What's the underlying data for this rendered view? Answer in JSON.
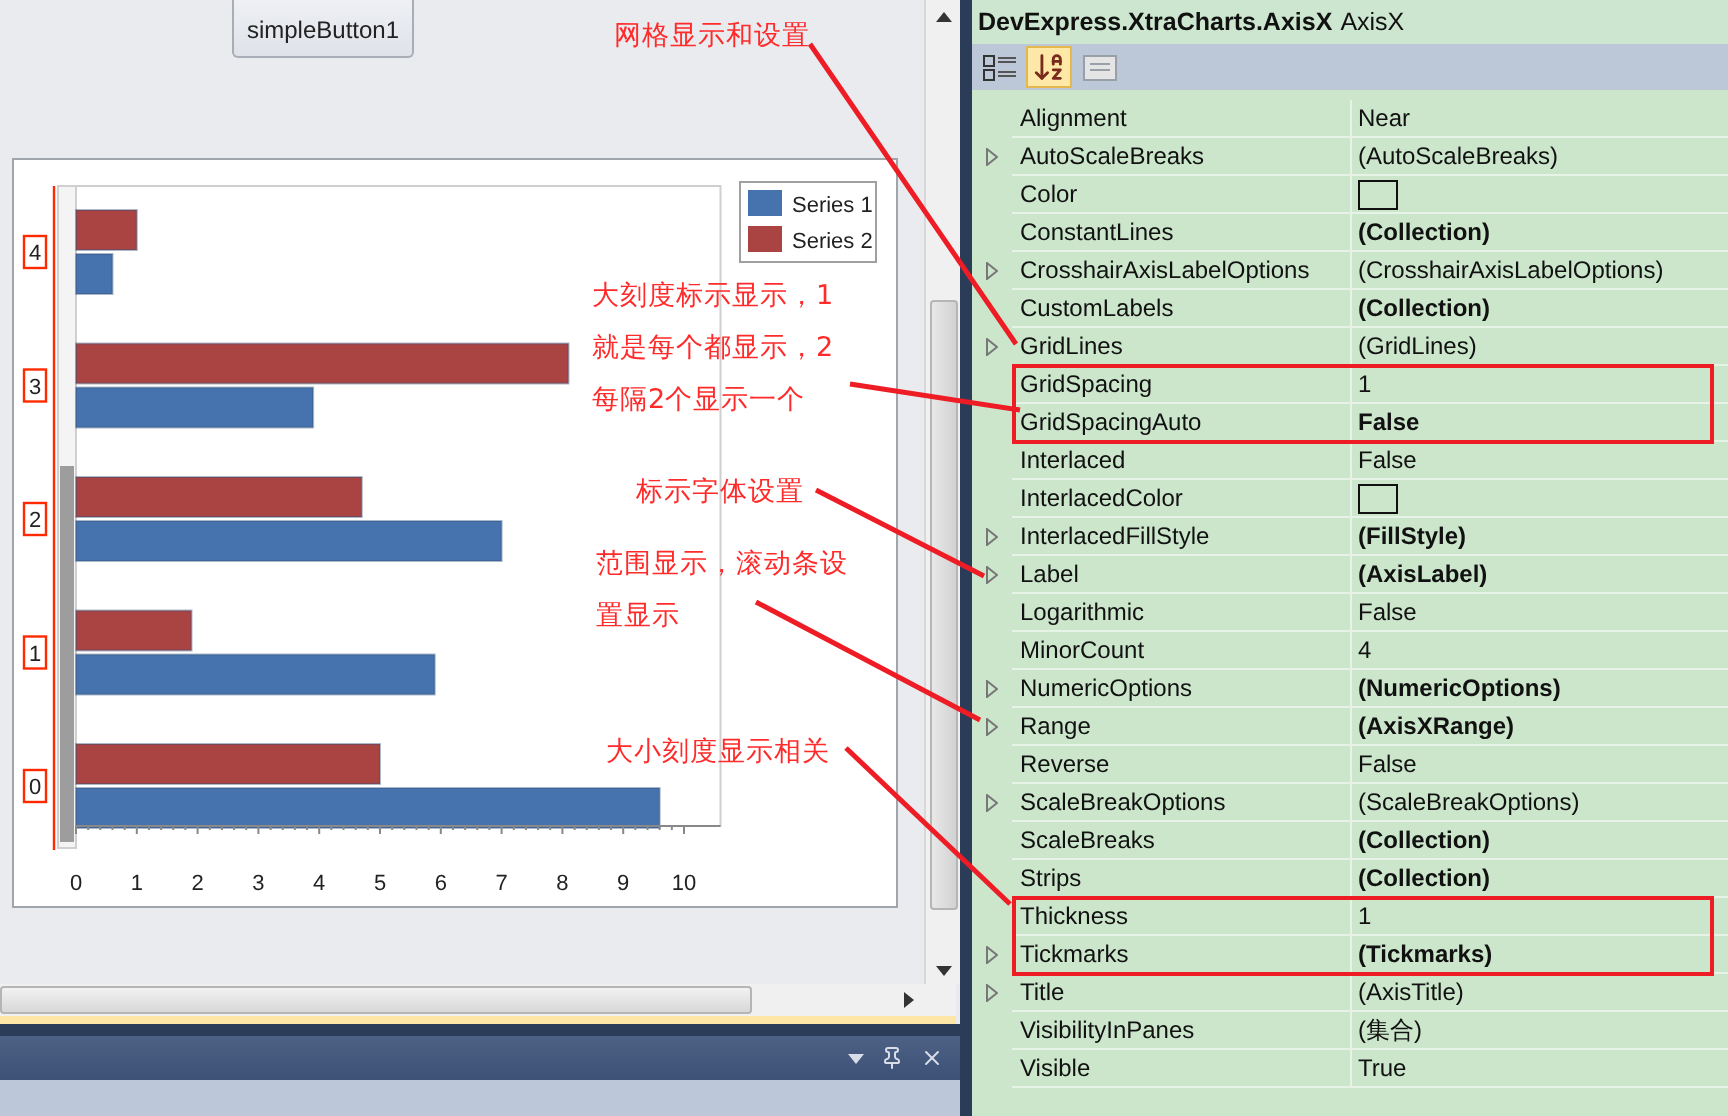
{
  "designer": {
    "button": {
      "label": "simpleButton1"
    },
    "chart": {
      "chart_data": {
        "type": "bar",
        "orientation": "horizontal",
        "categories": [
          "4",
          "3",
          "2",
          "1",
          "0"
        ],
        "series": [
          {
            "name": "Series 1",
            "color": "#4673ad",
            "values": [
              0.6,
              3.9,
              7.0,
              5.9,
              9.6
            ]
          },
          {
            "name": "Series 2",
            "color": "#a94442",
            "values": [
              1.0,
              8.1,
              4.7,
              1.9,
              5.0
            ]
          }
        ],
        "legend": true,
        "xlim": [
          0,
          10.6
        ],
        "xticks": [
          0,
          1,
          2,
          3,
          4,
          5,
          6,
          7,
          8,
          9,
          10
        ]
      }
    }
  },
  "property_grid": {
    "title": {
      "type": "DevExpress.XtraCharts.AxisX",
      "name": "AxisX"
    },
    "toolbar": [
      {
        "kind": "categorized",
        "selected": false
      },
      {
        "kind": "alphabetical",
        "selected": true
      },
      {
        "kind": "pages",
        "selected": false
      }
    ],
    "rows": [
      {
        "name": "Alignment",
        "kind": "text",
        "value": "Near",
        "bold": false,
        "expandable": false,
        "highlighted": false
      },
      {
        "name": "AutoScaleBreaks",
        "kind": "text",
        "value": "(AutoScaleBreaks)",
        "bold": false,
        "expandable": true,
        "highlighted": false
      },
      {
        "name": "Color",
        "kind": "swatch",
        "expandable": false,
        "highlighted": false
      },
      {
        "name": "ConstantLines",
        "kind": "text",
        "value": "(Collection)",
        "bold": true,
        "expandable": false,
        "highlighted": false
      },
      {
        "name": "CrosshairAxisLabelOptions",
        "kind": "text",
        "value": "(CrosshairAxisLabelOptions)",
        "bold": false,
        "expandable": true,
        "highlighted": false
      },
      {
        "name": "CustomLabels",
        "kind": "text",
        "value": "(Collection)",
        "bold": true,
        "expandable": false,
        "highlighted": false
      },
      {
        "name": "GridLines",
        "kind": "text",
        "value": "(GridLines)",
        "bold": false,
        "expandable": true,
        "highlighted": false
      },
      {
        "name": "GridSpacing",
        "kind": "text",
        "value": "1",
        "bold": false,
        "expandable": false,
        "highlighted": true
      },
      {
        "name": "GridSpacingAuto",
        "kind": "text",
        "value": "False",
        "bold": true,
        "expandable": false,
        "highlighted": true
      },
      {
        "name": "Interlaced",
        "kind": "text",
        "value": "False",
        "bold": false,
        "expandable": false,
        "highlighted": false
      },
      {
        "name": "InterlacedColor",
        "kind": "swatch",
        "expandable": false,
        "highlighted": false
      },
      {
        "name": "InterlacedFillStyle",
        "kind": "text",
        "value": "(FillStyle)",
        "bold": true,
        "expandable": true,
        "highlighted": false
      },
      {
        "name": "Label",
        "kind": "text",
        "value": "(AxisLabel)",
        "bold": true,
        "expandable": true,
        "highlighted": false
      },
      {
        "name": "Logarithmic",
        "kind": "text",
        "value": "False",
        "bold": false,
        "expandable": false,
        "highlighted": false
      },
      {
        "name": "MinorCount",
        "kind": "text",
        "value": "4",
        "bold": false,
        "expandable": false,
        "highlighted": false
      },
      {
        "name": "NumericOptions",
        "kind": "text",
        "value": "(NumericOptions)",
        "bold": true,
        "expandable": true,
        "highlighted": false
      },
      {
        "name": "Range",
        "kind": "text",
        "value": "(AxisXRange)",
        "bold": true,
        "expandable": true,
        "highlighted": false
      },
      {
        "name": "Reverse",
        "kind": "text",
        "value": "False",
        "bold": false,
        "expandable": false,
        "highlighted": false
      },
      {
        "name": "ScaleBreakOptions",
        "kind": "text",
        "value": "(ScaleBreakOptions)",
        "bold": false,
        "expandable": true,
        "highlighted": false
      },
      {
        "name": "ScaleBreaks",
        "kind": "text",
        "value": "(Collection)",
        "bold": true,
        "expandable": false,
        "highlighted": false
      },
      {
        "name": "Strips",
        "kind": "text",
        "value": "(Collection)",
        "bold": true,
        "expandable": false,
        "highlighted": false
      },
      {
        "name": "Thickness",
        "kind": "text",
        "value": "1",
        "bold": false,
        "expandable": false,
        "highlighted": true
      },
      {
        "name": "Tickmarks",
        "kind": "text",
        "value": "(Tickmarks)",
        "bold": true,
        "expandable": true,
        "highlighted": true
      },
      {
        "name": "Title",
        "kind": "text",
        "value": "(AxisTitle)",
        "bold": false,
        "expandable": true,
        "highlighted": false
      },
      {
        "name": "VisibilityInPanes",
        "kind": "text",
        "value": "(集合)",
        "bold": false,
        "expandable": false,
        "highlighted": false
      },
      {
        "name": "Visible",
        "kind": "text",
        "value": "True",
        "bold": false,
        "expandable": false,
        "highlighted": false
      }
    ]
  },
  "annotations": [
    {
      "lines": [
        "网格显示和设置"
      ]
    },
    {
      "lines": [
        "大刻度标示显示，1",
        "就是每个都显示，2",
        "每隔2个显示一个"
      ]
    },
    {
      "lines": [
        "标示字体设置"
      ]
    },
    {
      "lines": [
        "范围显示，滚动条设",
        "置显示"
      ]
    },
    {
      "lines": [
        "大小刻度显示相关"
      ]
    }
  ]
}
